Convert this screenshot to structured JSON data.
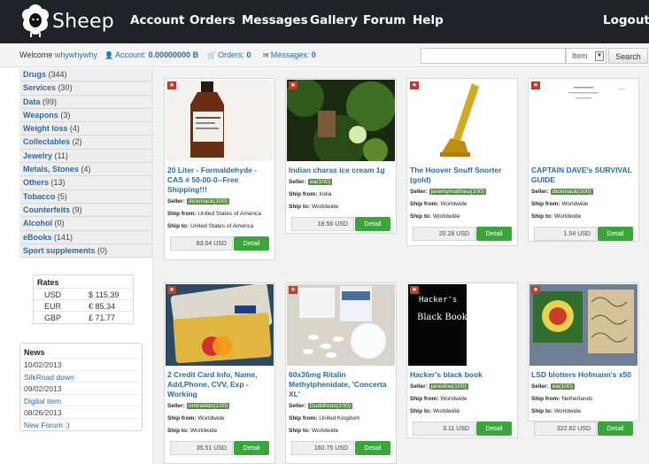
{
  "brand": {
    "name": "Sheep"
  },
  "nav": {
    "account": "Account",
    "orders": "Orders",
    "messages": "Messages",
    "gallery": "Gallery",
    "forum": "Forum",
    "help": "Help",
    "logout": "Logout"
  },
  "subbar": {
    "welcome_prefix": "Welcome",
    "username": "whywhywhy",
    "account_label": "Account:",
    "account_value": "0.00000000 B",
    "orders_label": "Orders:",
    "orders_value": "0",
    "messages_label": "Messages:",
    "messages_value": "0",
    "search_placeholder": "",
    "search_type": "Item",
    "search_button": "Search"
  },
  "categories": [
    {
      "name": "Drugs",
      "count": "(344)"
    },
    {
      "name": "Services",
      "count": "(30)"
    },
    {
      "name": "Data",
      "count": "(99)"
    },
    {
      "name": "Weapons",
      "count": "(3)"
    },
    {
      "name": "Weight loss",
      "count": "(4)"
    },
    {
      "name": "Collectables",
      "count": "(2)"
    },
    {
      "name": "Jewelry",
      "count": "(11)"
    },
    {
      "name": "Metals, Stones",
      "count": "(4)"
    },
    {
      "name": "Others",
      "count": "(13)"
    },
    {
      "name": "Tobacco",
      "count": "(5)"
    },
    {
      "name": "Counterfeits",
      "count": "(9)"
    },
    {
      "name": "Alcohol",
      "count": "(0)"
    },
    {
      "name": "eBooks",
      "count": "(141)"
    },
    {
      "name": "Sport supplements",
      "count": "(0)"
    }
  ],
  "rates": {
    "title": "Rates",
    "rows": [
      {
        "currency": "USD",
        "value": "$ 115.39"
      },
      {
        "currency": "EUR",
        "value": "€ 85.34"
      },
      {
        "currency": "GBP",
        "value": "£ 71.77"
      }
    ]
  },
  "news": {
    "title": "News",
    "items": [
      {
        "date": "10/02/2013",
        "text": "SilkRoad down"
      },
      {
        "date": "09/02/2013",
        "text": "Digital item"
      },
      {
        "date": "08/26/2013",
        "text": "New Forum :)"
      }
    ]
  },
  "labels": {
    "seller": "Seller:",
    "ship_from": "Ship from:",
    "ship_to": "Ship to:",
    "detail": "Detail"
  },
  "products": [
    {
      "title": "20 Liter - Formaldehyde - CAS # 50-00-0--Free Shipping!!!",
      "seller": "dickmack(100)",
      "ship_from": "United States of America",
      "ship_to": "United States of America",
      "price": "83.04 USD"
    },
    {
      "title": "Indian charas ice cream 1g",
      "seller": "ea(100)",
      "ship_from": "India",
      "ship_to": "Worldwide",
      "price": "18.56 USD"
    },
    {
      "title": "The Hoover Snuff Snorter (gold)",
      "seller": "jeremymathieu(100)",
      "ship_from": "Worldwide",
      "ship_to": "Worldwide",
      "price": "20.28 USD"
    },
    {
      "title": "CAPTAIN DAVE's SURVIVAL GUIDE",
      "seller": "dickmack(100)",
      "ship_from": "Worldwide",
      "ship_to": "Worldwide",
      "price": "1.04 USD"
    },
    {
      "title": "2 Credit Card Info, Name, Add,Phone, CVV, Exp - Working",
      "seller": "onlinelido(100)",
      "ship_from": "Worldwide",
      "ship_to": "Worldwide",
      "price": "35.51 USD"
    },
    {
      "title": "60x36mg Ritalin Methylphenidate, 'Concerta XL'",
      "seller": "Duddhism(100)",
      "ship_from": "United Kingdom",
      "ship_to": "Worldwide",
      "price": "160.75 USD"
    },
    {
      "title": "Hacker's black book",
      "seller": "janedoe(100)",
      "ship_from": "Worldwide",
      "ship_to": "Worldwide",
      "price": "3.11 USD"
    },
    {
      "title": "LSD blotters Hofmann's x50",
      "seller": "ea(100)",
      "ship_from": "Netherlands",
      "ship_to": "Worldwide",
      "price": "322.82 USD"
    }
  ],
  "book_cover": {
    "line1": "Hacker's",
    "line2": "Black Book"
  },
  "colors": {
    "topbar": "#1f2327",
    "link": "#2a6aa8",
    "detail_button": "#3aa63a",
    "seller_badge": "#5a8a4a",
    "featured_star": "#c0392b"
  }
}
